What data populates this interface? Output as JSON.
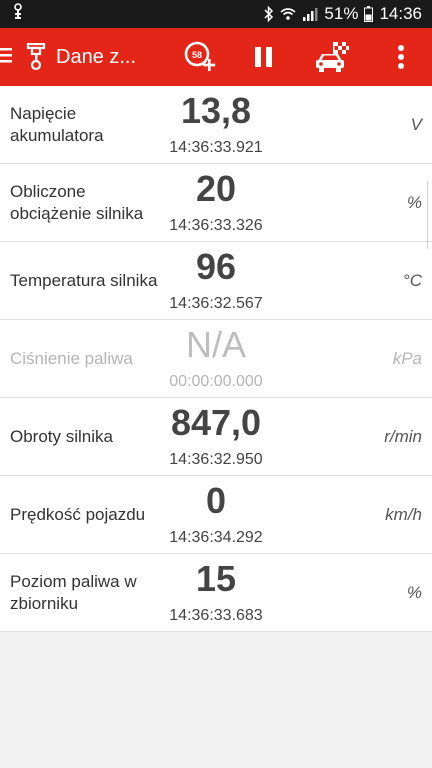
{
  "status_bar": {
    "battery_percent": "51%",
    "time": "14:36"
  },
  "app_bar": {
    "title": "Dane z...",
    "dashboard_badge": "58",
    "icons": [
      "menu-icon",
      "engine-icon",
      "add-dashboard-icon",
      "pause-icon",
      "car-race-icon",
      "overflow-menu-icon"
    ]
  },
  "sensors": [
    {
      "label": "Napięcie akumulatora",
      "value": "13,8",
      "timestamp": "14:36:33.921",
      "unit": "V"
    },
    {
      "label": "Obliczone obciążenie silnika",
      "value": "20",
      "timestamp": "14:36:33.326",
      "unit": "%"
    },
    {
      "label": "Temperatura silnika",
      "value": "96",
      "timestamp": "14:36:32.567",
      "unit": "°C"
    },
    {
      "label": "Ciśnienie paliwa",
      "value": "N/A",
      "timestamp": "00:00:00.000",
      "unit": "kPa"
    },
    {
      "label": "Obroty silnika",
      "value": "847,0",
      "timestamp": "14:36:32.950",
      "unit": "r/min"
    },
    {
      "label": "Prędkość pojazdu",
      "value": "0",
      "timestamp": "14:36:34.292",
      "unit": "km/h"
    },
    {
      "label": "Poziom paliwa w zbiorniku",
      "value": "15",
      "timestamp": "14:36:33.683",
      "unit": "%"
    }
  ],
  "colors": {
    "accent": "#e32618",
    "status_bar": "#1a1a1a",
    "background": "#f2f2f2"
  }
}
